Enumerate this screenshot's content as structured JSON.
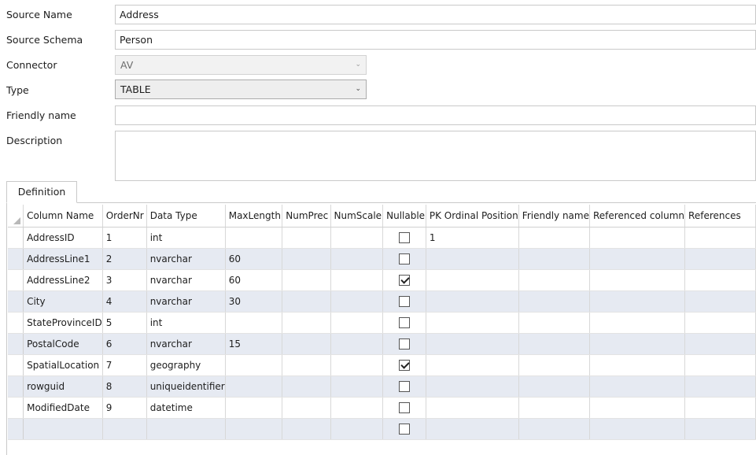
{
  "form": {
    "source_name_label": "Source Name",
    "source_name_value": "Address",
    "source_schema_label": "Source Schema",
    "source_schema_value": "Person",
    "connector_label": "Connector",
    "connector_value": "AV",
    "type_label": "Type",
    "type_value": "TABLE",
    "friendly_name_label": "Friendly name",
    "friendly_name_value": "",
    "description_label": "Description",
    "description_value": ""
  },
  "tabs": {
    "definition": "Definition"
  },
  "grid": {
    "columns": [
      "Column Name",
      "OrderNr",
      "Data Type",
      "MaxLength",
      "NumPrec",
      "NumScale",
      "Nullable",
      "PK Ordinal Position",
      "Friendly name",
      "Referenced column",
      "References"
    ],
    "rows": [
      {
        "name": "AddressID",
        "order": "1",
        "type": "int",
        "maxlen": "",
        "numprec": "",
        "numscale": "",
        "nullable": false,
        "pk": "1",
        "friendly": "",
        "refcol": "",
        "refs": ""
      },
      {
        "name": "AddressLine1",
        "order": "2",
        "type": "nvarchar",
        "maxlen": "60",
        "numprec": "",
        "numscale": "",
        "nullable": false,
        "pk": "",
        "friendly": "",
        "refcol": "",
        "refs": ""
      },
      {
        "name": "AddressLine2",
        "order": "3",
        "type": "nvarchar",
        "maxlen": "60",
        "numprec": "",
        "numscale": "",
        "nullable": true,
        "pk": "",
        "friendly": "",
        "refcol": "",
        "refs": ""
      },
      {
        "name": "City",
        "order": "4",
        "type": "nvarchar",
        "maxlen": "30",
        "numprec": "",
        "numscale": "",
        "nullable": false,
        "pk": "",
        "friendly": "",
        "refcol": "",
        "refs": ""
      },
      {
        "name": "StateProvinceID",
        "order": "5",
        "type": "int",
        "maxlen": "",
        "numprec": "",
        "numscale": "",
        "nullable": false,
        "pk": "",
        "friendly": "",
        "refcol": "",
        "refs": ""
      },
      {
        "name": "PostalCode",
        "order": "6",
        "type": "nvarchar",
        "maxlen": "15",
        "numprec": "",
        "numscale": "",
        "nullable": false,
        "pk": "",
        "friendly": "",
        "refcol": "",
        "refs": ""
      },
      {
        "name": "SpatialLocation",
        "order": "7",
        "type": "geography",
        "maxlen": "",
        "numprec": "",
        "numscale": "",
        "nullable": true,
        "pk": "",
        "friendly": "",
        "refcol": "",
        "refs": ""
      },
      {
        "name": "rowguid",
        "order": "8",
        "type": "uniqueidentifier",
        "maxlen": "",
        "numprec": "",
        "numscale": "",
        "nullable": false,
        "pk": "",
        "friendly": "",
        "refcol": "",
        "refs": ""
      },
      {
        "name": "ModifiedDate",
        "order": "9",
        "type": "datetime",
        "maxlen": "",
        "numprec": "",
        "numscale": "",
        "nullable": false,
        "pk": "",
        "friendly": "",
        "refcol": "",
        "refs": ""
      },
      {
        "name": "",
        "order": "",
        "type": "",
        "maxlen": "",
        "numprec": "",
        "numscale": "",
        "nullable": false,
        "pk": "",
        "friendly": "",
        "refcol": "",
        "refs": ""
      }
    ]
  },
  "colors": {
    "alt_row": "#e6eaf2",
    "border": "#c9c9c9",
    "combo_bg": "#f2f2f2"
  },
  "icons": {
    "dropdown": "chevron-down-icon",
    "checkbox": "checkbox-icon",
    "row_header_corner": "select-all-corner-icon"
  }
}
